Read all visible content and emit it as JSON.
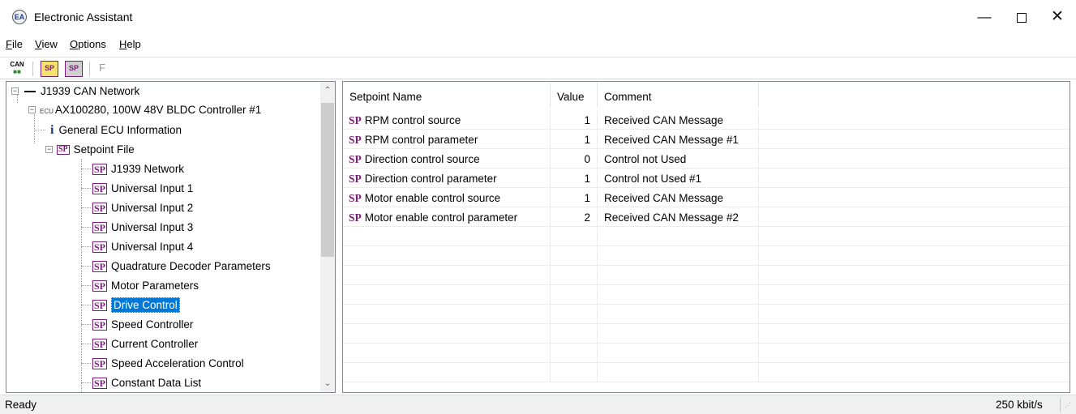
{
  "window": {
    "title": "Electronic Assistant",
    "app_icon": "electronic-assistant-logo",
    "minimize_glyph": "—",
    "close_glyph": "✕"
  },
  "menu": {
    "items": [
      {
        "label": "File",
        "mnemonic": "F",
        "rest": "ile"
      },
      {
        "label": "View",
        "mnemonic": "V",
        "rest": "iew"
      },
      {
        "label": "Options",
        "mnemonic": "O",
        "rest": "ptions"
      },
      {
        "label": "Help",
        "mnemonic": "H",
        "rest": "elp"
      }
    ]
  },
  "toolbar": {
    "can_label": "CAN",
    "sp_label": "SP",
    "f_label": "F"
  },
  "tree": {
    "root": "J1939 CAN Network",
    "ecu": "AX100280, 100W 48V BLDC Controller #1",
    "ecu_tag": "ECU",
    "info_glyph": "i",
    "info": "General ECU Information",
    "setpoint_file": "Setpoint File",
    "sp_glyph": "SP",
    "items": [
      "J1939 Network",
      "Universal Input 1",
      "Universal Input 2",
      "Universal Input 3",
      "Universal Input 4",
      "Quadrature Decoder Parameters",
      "Motor Parameters",
      "Drive Control",
      "Speed Controller",
      "Current Controller",
      "Speed Acceleration Control",
      "Constant Data List"
    ],
    "selected": "Drive Control",
    "expand_glyph": "−"
  },
  "grid": {
    "columns": [
      "Setpoint Name",
      "Value",
      "Comment"
    ],
    "sp_glyph": "SP",
    "rows": [
      {
        "name": "RPM control source",
        "value": "1",
        "comment": "Received CAN Message"
      },
      {
        "name": "RPM control parameter",
        "value": "1",
        "comment": "Received CAN Message #1"
      },
      {
        "name": "Direction control source",
        "value": "0",
        "comment": "Control not Used"
      },
      {
        "name": "Direction control parameter",
        "value": "1",
        "comment": "Control not Used #1"
      },
      {
        "name": "Motor enable control source",
        "value": "1",
        "comment": "Received CAN Message"
      },
      {
        "name": "Motor enable control parameter",
        "value": "2",
        "comment": "Received CAN Message #2"
      }
    ]
  },
  "status": {
    "text": "Ready",
    "baud": "250 kbit/s"
  }
}
